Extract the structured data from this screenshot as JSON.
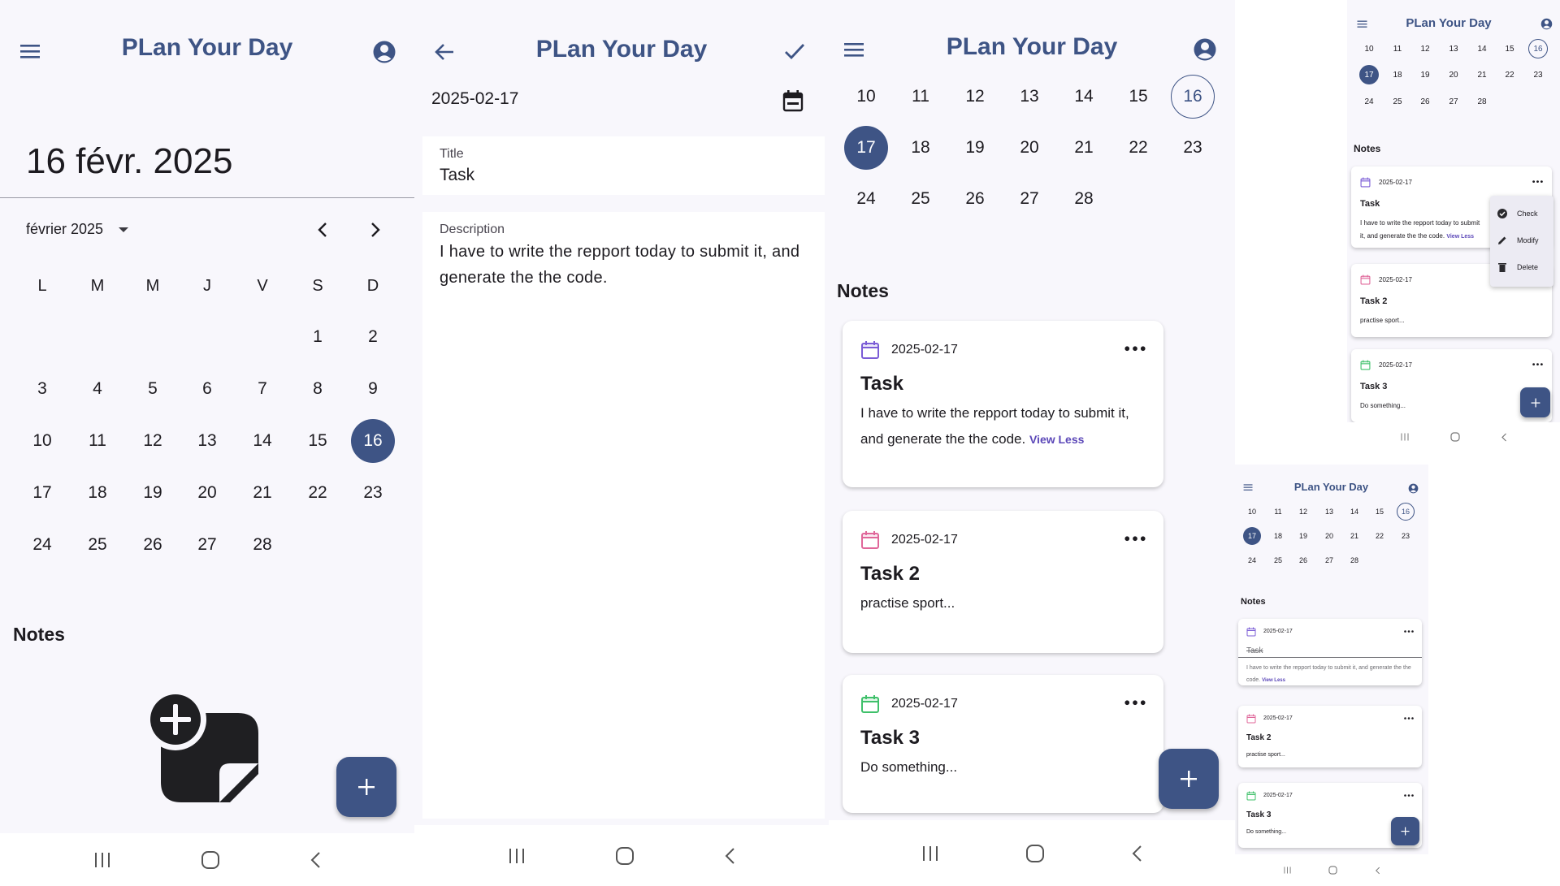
{
  "app": {
    "title": "PLan Your Day"
  },
  "colors": {
    "primary": "#3e5485",
    "purple": "#7b5cd6",
    "pink": "#e0679a",
    "green": "#3fc06a"
  },
  "screen1": {
    "big_date": "16 févr. 2025",
    "month_label": "février 2025",
    "weekdays": [
      "L",
      "M",
      "M",
      "J",
      "V",
      "S",
      "D"
    ],
    "weeks": [
      [
        "",
        "",
        "",
        "",
        "",
        "1",
        "2"
      ],
      [
        "3",
        "4",
        "5",
        "6",
        "7",
        "8",
        "9"
      ],
      [
        "10",
        "11",
        "12",
        "13",
        "14",
        "15",
        "16"
      ],
      [
        "17",
        "18",
        "19",
        "20",
        "21",
        "22",
        "23"
      ],
      [
        "24",
        "25",
        "26",
        "27",
        "28",
        "",
        ""
      ]
    ],
    "selected_day": "16",
    "notes_label": "Notes",
    "fab_label": "+"
  },
  "screen2": {
    "date_value": "2025-02-17",
    "title_label": "Title",
    "title_value": "Task",
    "description_label": "Description",
    "description_value": "I have to write the repport today to submit it, and generate the the code."
  },
  "week_strip": {
    "weeks": [
      [
        "10",
        "11",
        "12",
        "13",
        "14",
        "15",
        "16"
      ],
      [
        "17",
        "18",
        "19",
        "20",
        "21",
        "22",
        "23"
      ],
      [
        "24",
        "25",
        "26",
        "27",
        "28",
        "",
        ""
      ]
    ],
    "selected_day": "17",
    "today_day": "16"
  },
  "notes_label": "Notes",
  "notes": [
    {
      "date": "2025-02-17",
      "title": "Task",
      "body": "I have to write the repport today to submit it, and generate the the code.",
      "link": "View Less",
      "icon": "calendar-icon"
    },
    {
      "date": "2025-02-17",
      "title": "Task 2",
      "body": "practise sport...",
      "icon": "calendar-icon"
    },
    {
      "date": "2025-02-17",
      "title": "Task 3",
      "body": "Do something...",
      "icon": "calendar-icon"
    }
  ],
  "menu": {
    "items": [
      {
        "label": "Check",
        "icon": "check-circle-icon"
      },
      {
        "label": "Modify",
        "icon": "pencil-icon"
      },
      {
        "label": "Delete",
        "icon": "trash-icon"
      }
    ]
  }
}
